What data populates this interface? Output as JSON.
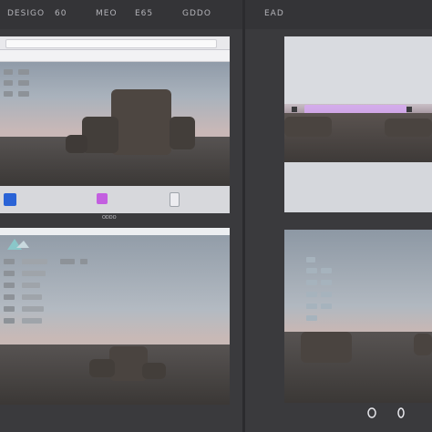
{
  "topbar": {
    "labels": [
      "DESIGO",
      "60",
      "MEO",
      "E65",
      "GDDO",
      "EAD"
    ]
  },
  "panels": {
    "top_left": {
      "bottom_caption": "ODDO"
    },
    "top_right": {},
    "bottom_left": {},
    "bottom_right": {}
  },
  "colors": {
    "accent_pink": "#d6a9f2",
    "accent_blue": "#2a63d6",
    "accent_magenta": "#c35fe0"
  }
}
